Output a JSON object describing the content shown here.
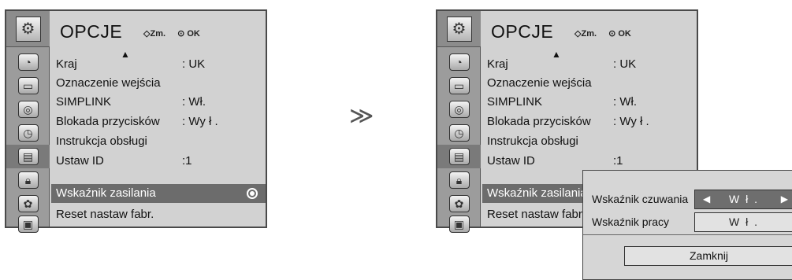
{
  "menu": {
    "title": "OPCJE",
    "hint_move": "Zm.",
    "hint_ok": "OK",
    "items": [
      {
        "label": "Kraj",
        "value": ": UK"
      },
      {
        "label": "Oznaczenie wejścia",
        "value": ""
      },
      {
        "label": "SIMPLINK",
        "value": ":  Wł."
      },
      {
        "label": "Blokada przycisków",
        "value": ": Wy ł ."
      },
      {
        "label": "Instrukcja obsługi",
        "value": ""
      },
      {
        "label": "Ustaw ID",
        "value": ":1"
      },
      {
        "label": "Wskaźnik zasilania",
        "value": ""
      },
      {
        "label": "Reset nastaw fabr.",
        "value": ""
      }
    ],
    "selected_index": 6
  },
  "separator": "≫",
  "popup": {
    "standby_label": "Wskaźnik czuwania",
    "standby_value": "W ł .",
    "power_label": "Wskaźnik pracy",
    "power_value": "W ł .",
    "close_label": "Zamknij"
  },
  "colors": {
    "panel_bg": "#d2d2d2",
    "icon_column": "#9c9c9c",
    "highlight": "#6c6c6c",
    "border": "#4a4a4a"
  },
  "icons": [
    "options-icon",
    "satellite-icon",
    "tv-icon",
    "speaker-icon",
    "clock-icon",
    "options-icon",
    "lock-icon",
    "globe-icon",
    "picture-icon"
  ]
}
